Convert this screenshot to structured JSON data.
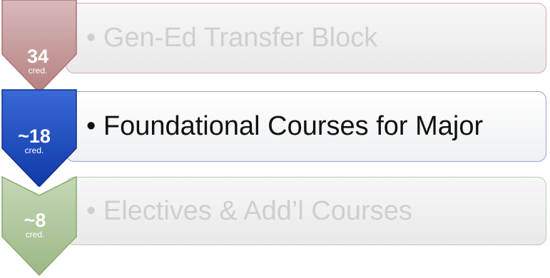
{
  "steps": [
    {
      "credits": "34",
      "unit": "cred.",
      "label": "• Gen-Ed Transfer Block",
      "active": false,
      "chevron_fill": "#c69c9c",
      "chevron_stroke": "#b07070",
      "box_border": "#d9a9a9",
      "text_color": "#cfcfcf"
    },
    {
      "credits": "~18",
      "unit": "cred.",
      "label": "• Foundational Courses for Major",
      "active": true,
      "chevron_fill": "#1f4fc4",
      "chevron_stroke": "#12308a",
      "box_border": "#8ea6cf",
      "text_color": "#111111"
    },
    {
      "credits": "~8",
      "unit": "cred.",
      "label": "• Electives & Add’l Courses",
      "active": false,
      "chevron_fill": "#adc59a",
      "chevron_stroke": "#87aa6c",
      "box_border": "#b9cfa8",
      "text_color": "#cfcfcf"
    }
  ]
}
